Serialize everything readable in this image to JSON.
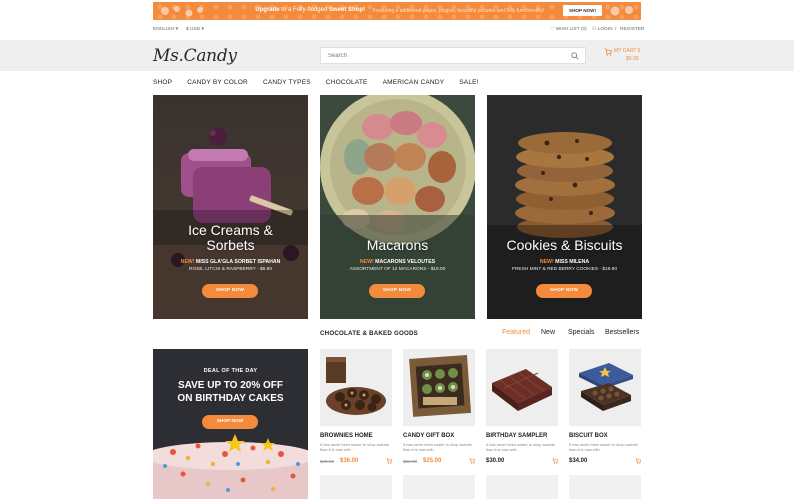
{
  "promo": {
    "lead_pre": "Upgrade",
    "lead_mid": " to a Fully-fledged ",
    "lead_bold": "Sweet Shop!",
    "subtext": "Featuring a additional pages, plugins, beautiful pictures and fully functionality!",
    "button": "SHOP NOW!"
  },
  "topbar": {
    "language": "ENGLISH",
    "currency": "$ USD",
    "wishlist": "WISH LIST (0)",
    "login": "LOGIN",
    "register": "REGISTER"
  },
  "header": {
    "logo": "Ms.Candy",
    "search_placeholder": "Search",
    "cart_label": "MY CART 0",
    "cart_total": "$0.00"
  },
  "nav": [
    "SHOP",
    "CANDY BY COLOR",
    "CANDY TYPES",
    "CHOCOLATE",
    "AMERICAN CANDY",
    "SALE!"
  ],
  "heroes": [
    {
      "title_1": "Ice Creams &",
      "title_2": "Sorbets",
      "new_label": "NEW!",
      "name": " MISS GLA'GLA SORBET ISPAHAN",
      "detail": "ROSE, LITCHI & RASPBERRY - $8.90",
      "button": "SHOP NOW"
    },
    {
      "title_1": "Macarons",
      "title_2": "",
      "new_label": "NEW!",
      "name": " MACARONS VELOUTES",
      "detail": "ASSORTMENT OF 12 MACARONS - $19.00",
      "button": "SHOP NOW"
    },
    {
      "title_1": "Cookies & Biscuits",
      "title_2": "",
      "new_label": "NEW!",
      "name": " MISS MILENA",
      "detail": "FRESH MINT & RED BERRY COOKIES - $18.90",
      "button": "SHOP NOW"
    }
  ],
  "section": {
    "title": "CHOCOLATE & BAKED GOODS",
    "tabs": [
      "Featured",
      "New",
      "Specials",
      "Bestsellers"
    ]
  },
  "deal": {
    "label": "DEAL OF THE DAY",
    "headline_1": "SAVE UP TO 20% OFF",
    "headline_2": "ON BIRTHDAY CAKES",
    "button": "SHOP NOW"
  },
  "products": [
    {
      "name": "BROWNIES HOME",
      "desc": "It has never been easier to shop sweets than it is now with",
      "old_price": "$45.00",
      "price": "$36.00"
    },
    {
      "name": "CANDY GIFT BOX",
      "desc": "It has never been easier to shop sweets than it is now with",
      "old_price": "$32.00",
      "price": "$25.00"
    },
    {
      "name": "BIRTHDAY SAMPLER",
      "desc": "It has never been easier to shop sweets than it is now with",
      "old_price": "",
      "price": "$30.00"
    },
    {
      "name": "BISCUIT BOX",
      "desc": "It has never been easier to shop sweets than it is now with",
      "old_price": "",
      "price": "$34.00"
    }
  ],
  "colors": {
    "accent": "#f48a3c",
    "header_bg": "#efefef",
    "deal_bg": "#2c2e33"
  }
}
